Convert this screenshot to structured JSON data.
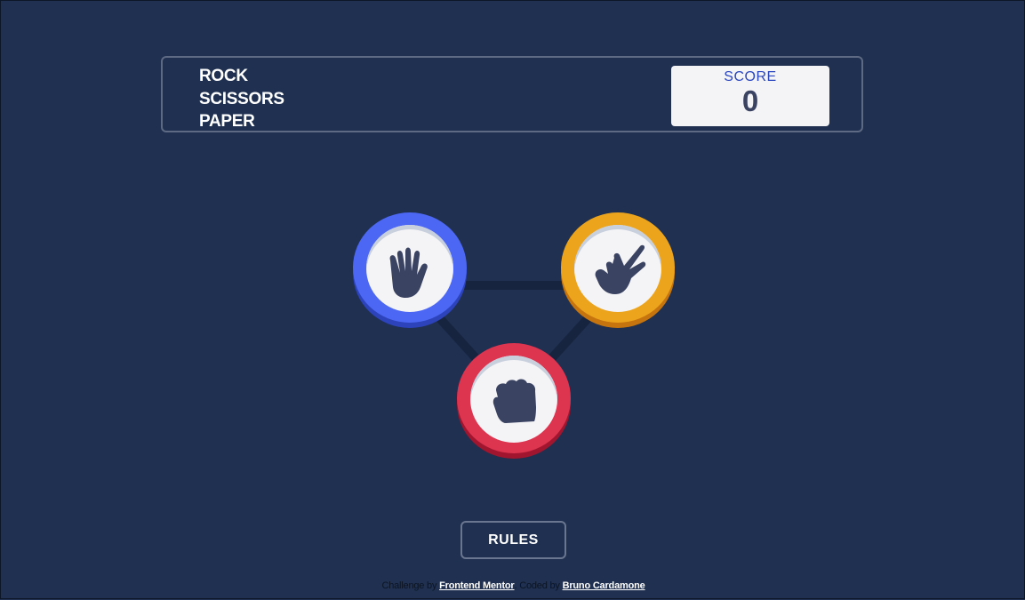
{
  "header": {
    "title_lines": [
      "ROCK",
      "SCISSORS",
      "PAPER"
    ],
    "score": {
      "label": "SCORE",
      "value": "0"
    }
  },
  "board": {
    "choices": [
      {
        "name": "paper",
        "icon": "hand-paper-icon",
        "ring_color": "#4c67f4"
      },
      {
        "name": "scissors",
        "icon": "hand-scissors-icon",
        "ring_color": "#eca41d"
      },
      {
        "name": "rock",
        "icon": "hand-rock-icon",
        "ring_color": "#dd3450"
      }
    ]
  },
  "rules_button": {
    "label": "RULES"
  },
  "footer": {
    "challenge_prefix": "Challenge by",
    "challenge_link": "Frontend Mentor",
    "coded_prefix": ". Coded by",
    "coded_link": "Bruno Cardamone"
  },
  "colors": {
    "background": "#1f3050",
    "header_outline": "#5e6a83",
    "score_label": "#2a46c0",
    "score_value": "#3b4363"
  }
}
